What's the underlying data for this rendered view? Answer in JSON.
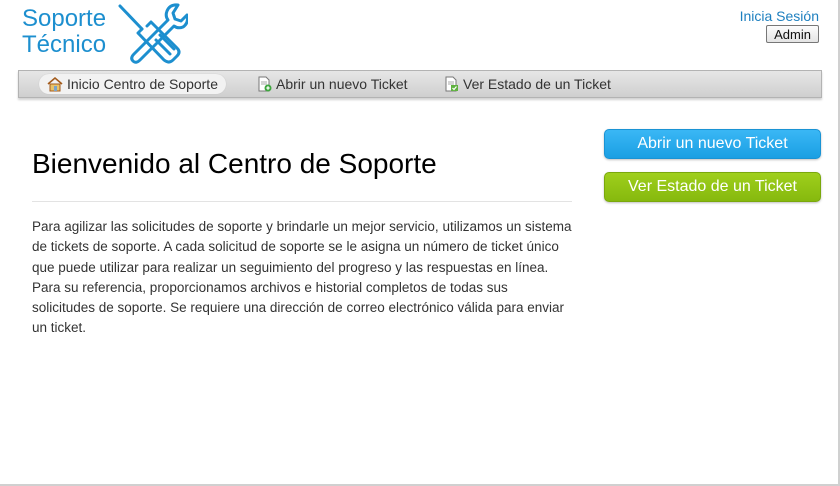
{
  "header": {
    "logo_line1": "Soporte",
    "logo_line2": "Técnico",
    "logo_icon": "wrench-screwdriver-icon",
    "signin_label": "Inicia Sesión",
    "admin_label": "Admin"
  },
  "nav": {
    "items": [
      {
        "label": "Inicio Centro de Soporte",
        "icon": "home-icon",
        "active": true
      },
      {
        "label": "Abrir un nuevo Ticket",
        "icon": "new-ticket-icon",
        "active": false
      },
      {
        "label": "Ver Estado de un Ticket",
        "icon": "ticket-status-icon",
        "active": false
      }
    ]
  },
  "main": {
    "title": "Bienvenido al Centro de Soporte",
    "intro": "Para agilizar las solicitudes de soporte y brindarle un mejor servicio, utilizamos un sistema de tickets de soporte. A cada solicitud de soporte se le asigna un número de ticket único que puede utilizar para realizar un seguimiento del progreso y las respuestas en línea. Para su referencia, proporcionamos archivos e historial completos de todas sus solicitudes de soporte. Se requiere una dirección de correo electrónico válida para enviar un ticket."
  },
  "sidebar": {
    "open_ticket_label": "Abrir un nuevo Ticket",
    "check_status_label": "Ver Estado de un Ticket"
  },
  "colors": {
    "brand": "#1d8fcf",
    "open_button": "#1a9fe3",
    "status_button": "#86b90e"
  }
}
